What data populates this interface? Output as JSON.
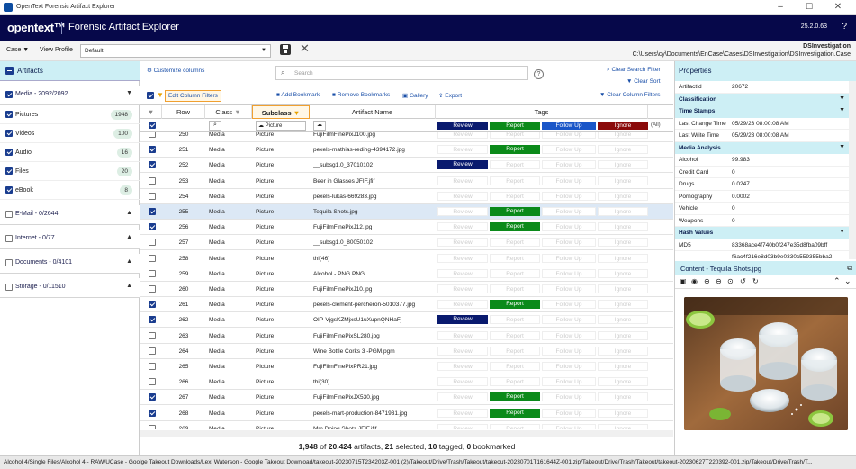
{
  "window": {
    "title": "OpenText Forensic Artifact Explorer"
  },
  "header": {
    "logo": "opentext™",
    "product": "Forensic Artifact Explorer",
    "version": "25.2.0.63",
    "help": "?"
  },
  "toolbar": {
    "case_label": "Case",
    "view_profile_label": "View Profile",
    "profile_value": "Default",
    "investigation_name": "DSInvestigation",
    "investigation_path": "C:\\Users\\cy\\Documents\\EnCase\\Cases\\DSInvestigation\\DSInvestigation.Case"
  },
  "left": {
    "header": "Artifacts",
    "media_group": "Media - 2092/2092",
    "media_items": [
      {
        "label": "Pictures",
        "count": "1948"
      },
      {
        "label": "Videos",
        "count": "100"
      },
      {
        "label": "Audio",
        "count": "16"
      },
      {
        "label": "Files",
        "count": "20"
      },
      {
        "label": "eBook",
        "count": "8"
      }
    ],
    "groups": [
      "E-Mail - 0/2644",
      "Internet - 0/77",
      "Documents - 0/4101",
      "Storage - 0/11510"
    ]
  },
  "center": {
    "customize": "Customize columns",
    "search_placeholder": "Search",
    "clear_search": "Clear Search Filter",
    "clear_sort": "Clear Sort",
    "edit_filters": "Edit Column Filters",
    "add_bookmark": "Add Bookmark",
    "remove_bookmarks": "Remove Bookmarks",
    "gallery": "Gallery",
    "export": "Export",
    "clear_column_filters": "Clear Column Filters",
    "columns": {
      "row": "Row",
      "class": "Class",
      "subclass": "Subclass",
      "artifact_name": "Artifact Name",
      "tags": "Tags"
    },
    "subclass_filter": "Picture",
    "tag_headers": [
      "Review",
      "Report",
      "Follow Up",
      "Ignore"
    ],
    "tag_all": "(All)",
    "tag_labels": {
      "review": "Review",
      "report": "Report",
      "follow": "Follow Up",
      "ignore": "Ignore"
    },
    "rows": [
      {
        "row": "250",
        "cls": "Media",
        "sub": "Picture",
        "name": "FujiFilmFinePixJ100.jpg",
        "checked": false,
        "tag": "none"
      },
      {
        "row": "251",
        "cls": "Media",
        "sub": "Picture",
        "name": "pexels-mathias-reding-4394172.jpg",
        "checked": true,
        "tag": "report"
      },
      {
        "row": "252",
        "cls": "Media",
        "sub": "Picture",
        "name": "__subsg1.0_37010102",
        "checked": true,
        "tag": "review"
      },
      {
        "row": "253",
        "cls": "Media",
        "sub": "Picture",
        "name": "Beer in Glasses JFIF.jfif",
        "checked": false,
        "tag": "none"
      },
      {
        "row": "254",
        "cls": "Media",
        "sub": "Picture",
        "name": "pexels-lukas-669283.jpg",
        "checked": false,
        "tag": "none"
      },
      {
        "row": "255",
        "cls": "Media",
        "sub": "Picture",
        "name": "Tequila Shots.jpg",
        "checked": true,
        "tag": "report",
        "selected": true
      },
      {
        "row": "256",
        "cls": "Media",
        "sub": "Picture",
        "name": "FujiFilmFinePixJ12.jpg",
        "checked": true,
        "tag": "report"
      },
      {
        "row": "257",
        "cls": "Media",
        "sub": "Picture",
        "name": "__subsg1.0_80050102",
        "checked": false,
        "tag": "none"
      },
      {
        "row": "258",
        "cls": "Media",
        "sub": "Picture",
        "name": "thi(46)",
        "checked": false,
        "tag": "none"
      },
      {
        "row": "259",
        "cls": "Media",
        "sub": "Picture",
        "name": "Alcohol - PNG.PNG",
        "checked": false,
        "tag": "none"
      },
      {
        "row": "260",
        "cls": "Media",
        "sub": "Picture",
        "name": "FujiFilmFinePixJ10.jpg",
        "checked": false,
        "tag": "none"
      },
      {
        "row": "261",
        "cls": "Media",
        "sub": "Picture",
        "name": "pexels-clement-percheron-5010377.jpg",
        "checked": true,
        "tag": "report"
      },
      {
        "row": "262",
        "cls": "Media",
        "sub": "Picture",
        "name": "OIP-VjgsKZMjxsU1uXupnQNHaFj",
        "checked": true,
        "tag": "review"
      },
      {
        "row": "263",
        "cls": "Media",
        "sub": "Picture",
        "name": "FujiFilmFinePixSL280.jpg",
        "checked": false,
        "tag": "none"
      },
      {
        "row": "264",
        "cls": "Media",
        "sub": "Picture",
        "name": "Wine Bottle Corks 3 -PGM.pgm",
        "checked": false,
        "tag": "none"
      },
      {
        "row": "265",
        "cls": "Media",
        "sub": "Picture",
        "name": "FujiFilmFinePixPR21.jpg",
        "checked": false,
        "tag": "none"
      },
      {
        "row": "266",
        "cls": "Media",
        "sub": "Picture",
        "name": "thi(30)",
        "checked": false,
        "tag": "none"
      },
      {
        "row": "267",
        "cls": "Media",
        "sub": "Picture",
        "name": "FujiFilmFinePixJX530.jpg",
        "checked": true,
        "tag": "report"
      },
      {
        "row": "268",
        "cls": "Media",
        "sub": "Picture",
        "name": "pexels-mart-production-8471931.jpg",
        "checked": true,
        "tag": "report"
      },
      {
        "row": "269",
        "cls": "Media",
        "sub": "Picture",
        "name": "Mm Doing Shots JFIF.jfif",
        "checked": false,
        "tag": "none"
      }
    ]
  },
  "summary": {
    "a": "1,948",
    "of": "of",
    "b": "20,424",
    "artifacts": "artifacts,",
    "sel": "21",
    "selected": "selected,",
    "tag": "10",
    "tagged": "tagged,",
    "bm": "0",
    "bookmarked": "bookmarked"
  },
  "status": "Alcohol 4/Single Files/Alcohol 4 - RAW/UCase - Goolge Takeout Downloads/Lexi Waterson - Google Takeout Download/takeout-20230715T234203Z-001 (2)/Takeout/Drive/Trash/Takeout/takeout-20230701T161644Z-001.zip/Takeout/Drive/Trash/Takeout/takeout-20230627T220392-001.zip/Takeout/Drive/Trash/T...",
  "right": {
    "header": "Properties",
    "props": [
      {
        "k": "ArtifactId",
        "v": "20672",
        "type": "row"
      },
      {
        "k": "Classification",
        "type": "sec"
      },
      {
        "k": "Time Stamps",
        "type": "sec"
      },
      {
        "k": "Last Change Time",
        "v": "05/29/23 08:00:08 AM",
        "type": "row"
      },
      {
        "k": "Last Write Time",
        "v": "05/29/23 08:00:08 AM",
        "type": "row"
      },
      {
        "k": "Media Analysis",
        "type": "sec"
      },
      {
        "k": "Alcohol",
        "v": "99.983",
        "type": "row"
      },
      {
        "k": "Credit Card",
        "v": "0",
        "type": "row"
      },
      {
        "k": "Drugs",
        "v": "0.0247",
        "type": "row"
      },
      {
        "k": "Pornography",
        "v": "0.0002",
        "type": "row"
      },
      {
        "k": "Vehicle",
        "v": "0",
        "type": "row"
      },
      {
        "k": "Weapons",
        "v": "0",
        "type": "row"
      },
      {
        "k": "Hash Values",
        "type": "sec"
      },
      {
        "k": "MD5",
        "v": "83368ace4f740b0f247e35d8fba09bff",
        "type": "row"
      },
      {
        "k": "",
        "v": "f6ac4f216e8d03b9e0330c559355bba2",
        "type": "row"
      }
    ],
    "content_title": "Content - Tequila Shots.jpg"
  }
}
